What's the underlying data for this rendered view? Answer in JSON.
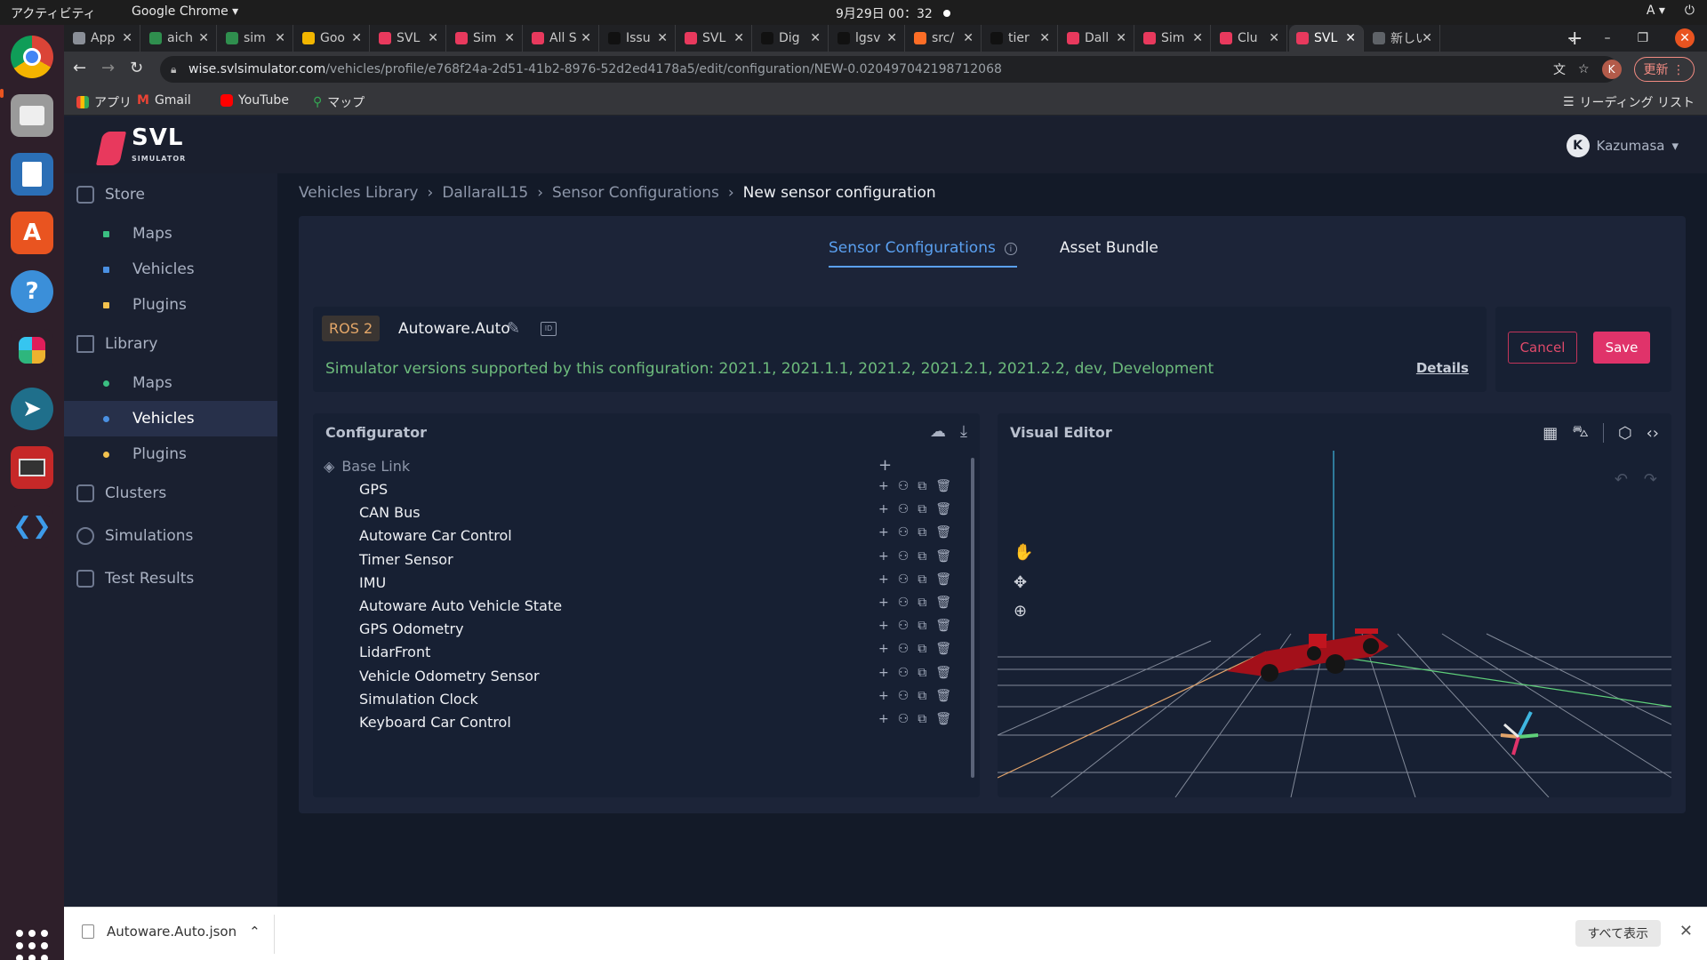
{
  "os": {
    "activities": "アクティビティ",
    "app_name": "Google Chrome ▾",
    "clock": "9月29日 00：32",
    "tray": [
      "A ▾",
      "⏻"
    ]
  },
  "browser": {
    "tabs": [
      {
        "title": "App",
        "color": "#8a8f98"
      },
      {
        "title": "aich",
        "color": "#2f8f4e"
      },
      {
        "title": "sim",
        "color": "#2f8f4e"
      },
      {
        "title": "Goo",
        "color": "#f2b600"
      },
      {
        "title": "SVL",
        "color": "#e8395d"
      },
      {
        "title": "Sim",
        "color": "#e8395d"
      },
      {
        "title": "All S",
        "color": "#e8395d"
      },
      {
        "title": "Issu",
        "color": "#111111"
      },
      {
        "title": "SVL",
        "color": "#e8395d"
      },
      {
        "title": "Dig",
        "color": "#111111"
      },
      {
        "title": "lgsv",
        "color": "#111111"
      },
      {
        "title": "src/",
        "color": "#fc6d26"
      },
      {
        "title": "tier",
        "color": "#111111"
      },
      {
        "title": "Dall",
        "color": "#e8395d"
      },
      {
        "title": "Sim",
        "color": "#e8395d"
      },
      {
        "title": "Clu",
        "color": "#e8395d"
      },
      {
        "title": "SVL",
        "color": "#e8395d",
        "active": true
      },
      {
        "title": "新しい",
        "color": "#5f6368"
      }
    ],
    "url_host": "wise.svlsimulator.com",
    "url_path": "/vehicles/profile/e768f24a-2d51-41b2-8976-52d2ed4178a5/edit/configuration/NEW-0.020497042198712068",
    "profile_initial": "K",
    "update_label": "更新",
    "bookmarks": [
      "アプリ",
      "Gmail",
      "YouTube",
      "マップ"
    ],
    "reading_list": "リーディング リスト"
  },
  "app": {
    "logo": "SVL",
    "logo_sub": "SIMULATOR",
    "user": "Kazumasa",
    "user_initial": "K",
    "sidebar": {
      "store": "Store",
      "store_items": [
        "Maps",
        "Vehicles",
        "Plugins"
      ],
      "library": "Library",
      "library_items": [
        "Maps",
        "Vehicles",
        "Plugins"
      ],
      "clusters": "Clusters",
      "simulations": "Simulations",
      "test_results": "Test Results"
    },
    "breadcrumb": [
      "Vehicles Library",
      "DallaraIL15",
      "Sensor Configurations",
      "New sensor configuration"
    ],
    "tabs": [
      "Sensor Configurations",
      "Asset Bundle"
    ],
    "bridge": "ROS 2",
    "config_name": "Autoware.Auto",
    "versions": "Simulator versions supported by this configuration: 2021.1, 2021.1.1, 2021.2, 2021.2.1, 2021.2.2, dev, Development",
    "details": "Details",
    "cancel": "Cancel",
    "save": "Save",
    "configurator": {
      "title": "Configurator",
      "root": "Base Link",
      "sensors": [
        "GPS",
        "CAN Bus",
        "Autoware Car Control",
        "Timer Sensor",
        "IMU",
        "Autoware Auto Vehicle State",
        "GPS Odometry",
        "LidarFront",
        "Vehicle Odometry Sensor",
        "Simulation Clock",
        "Keyboard Car Control"
      ]
    },
    "visual_editor": {
      "title": "Visual Editor"
    }
  },
  "download": {
    "file": "Autoware.Auto.json",
    "show_all": "すべて表示"
  },
  "colors": {
    "accent": "#5aa0f0",
    "brand": "#e8395d",
    "save": "#e0336a",
    "versions_text": "#6dbb7c",
    "ros_text": "#e4a769"
  }
}
